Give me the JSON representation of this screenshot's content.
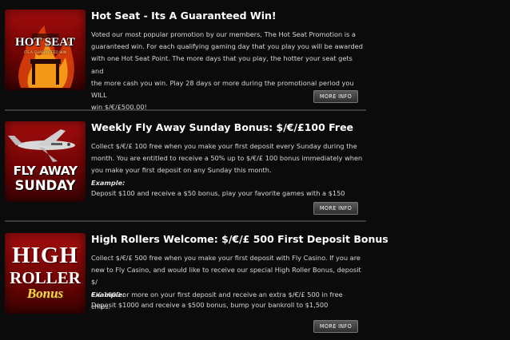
{
  "colors": {
    "background": "#0b0b0b",
    "title": "#ffffff",
    "body_text": "#d7d7d7",
    "thumb_red": "#a40d0d",
    "divider": "#3a3a3a"
  },
  "promos": [
    {
      "title": "Hot Seat - Its A Guaranteed Win!",
      "image_text": {
        "line1": "HOT SEAT",
        "line2": "ITS A GUARANTEED WIN"
      },
      "image_icon": "flaming-chair-icon",
      "description_lines": [
        "Voted our most popular promotion by our members, The Hot Seat Promotion is a",
        "guaranteed win. For each qualifying gaming day that you play you will be awarded",
        "with one Hot Seat Point. The more days that you play, the hotter your seat gets and",
        "the more cash you win. Play 28 days or more during the promotional period you WILL",
        "win $/€/£500.00!"
      ],
      "button": "MORE INFO"
    },
    {
      "title": "Weekly Fly Away Sunday Bonus: $/€/£100 Free",
      "image_text": {
        "line1": "FLY AWAY",
        "line2": "SUNDAY"
      },
      "image_icon": "private-jet-icon",
      "description_lines": [
        "Collect $/€/£ 100 free when you make your first deposit every Sunday during the",
        "month. You are entitled to receive a 50% up to $/€/£ 100 bonus immediately when",
        "you make your first deposit on any Sunday this month."
      ],
      "example_label": "Example:",
      "example_text": "Deposit $100 and receive a $50 bonus, play your favorite games with a $150",
      "button": "MORE INFO"
    },
    {
      "title": "High Rollers Welcome: $/€/£ 500 First Deposit Bonus",
      "image_text": {
        "line1": "HIGH",
        "line2": "ROLLER",
        "line3": "Bonus"
      },
      "image_icon": "high-roller-logo",
      "description_lines": [
        "Collect $/€/£ 500 free when you make your first deposit with Fly Casino. If you are",
        "new to Fly Casino, and would like to receive our special High Roller Bonus, deposit $/",
        "€/£ 1000 or more on your first deposit and receive an extra $/€/£ 500 in free chips."
      ],
      "example_label": "Example:",
      "example_text": "Deposit $1000 and receive a $500 bonus, bump your bankroll to $1,500",
      "button": "MORE INFO"
    }
  ]
}
